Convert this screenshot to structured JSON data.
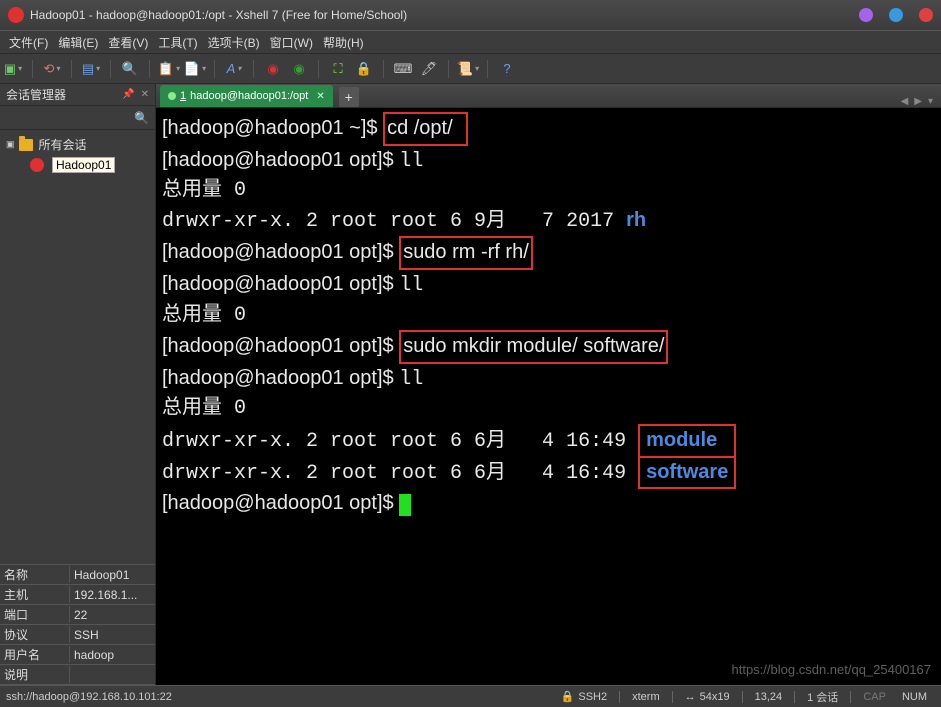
{
  "window": {
    "title": "Hadoop01 - hadoop@hadoop01:/opt - Xshell 7 (Free for Home/School)"
  },
  "menu": {
    "file": "文件(F)",
    "edit": "编辑(E)",
    "view": "查看(V)",
    "tools": "工具(T)",
    "tab": "选项卡(B)",
    "window": "窗口(W)",
    "help": "帮助(H)"
  },
  "sidebar": {
    "title": "会话管理器",
    "root": "所有会话",
    "session": "Hadoop01",
    "props": [
      {
        "k": "名称",
        "v": "Hadoop01"
      },
      {
        "k": "主机",
        "v": "192.168.1..."
      },
      {
        "k": "端口",
        "v": "22"
      },
      {
        "k": "协议",
        "v": "SSH"
      },
      {
        "k": "用户名",
        "v": "hadoop"
      },
      {
        "k": "说明",
        "v": ""
      }
    ]
  },
  "tab": {
    "index": "1",
    "label": "hadoop@hadoop01:/opt"
  },
  "term": {
    "p1": "[hadoop@hadoop01 ~]$ ",
    "cmd1": "cd /opt/",
    "p2": "[hadoop@hadoop01 opt]$ ",
    "ll": "ll",
    "tot": "总用量 0",
    "rhline": "drwxr-xr-x. 2 root root 6 9月   7 2017 ",
    "rh": "rh",
    "cmd2": "sudo rm -rf rh/",
    "cmd3": "sudo mkdir module/ software/",
    "modline": "drwxr-xr-x. 2 root root 6 6月   4 16:49 ",
    "mod": "module",
    "swline": "drwxr-xr-x. 2 root root 6 6月   4 16:49 ",
    "sw": "software"
  },
  "status": {
    "conn": "ssh://hadoop@192.168.10.101:22",
    "proto": "SSH2",
    "termtype": "xterm",
    "size": "54x19",
    "pos": "13,24",
    "sess": "1 会话",
    "cap": "CAP",
    "num": "NUM"
  },
  "watermark": "https://blog.csdn.net/qq_25400167"
}
